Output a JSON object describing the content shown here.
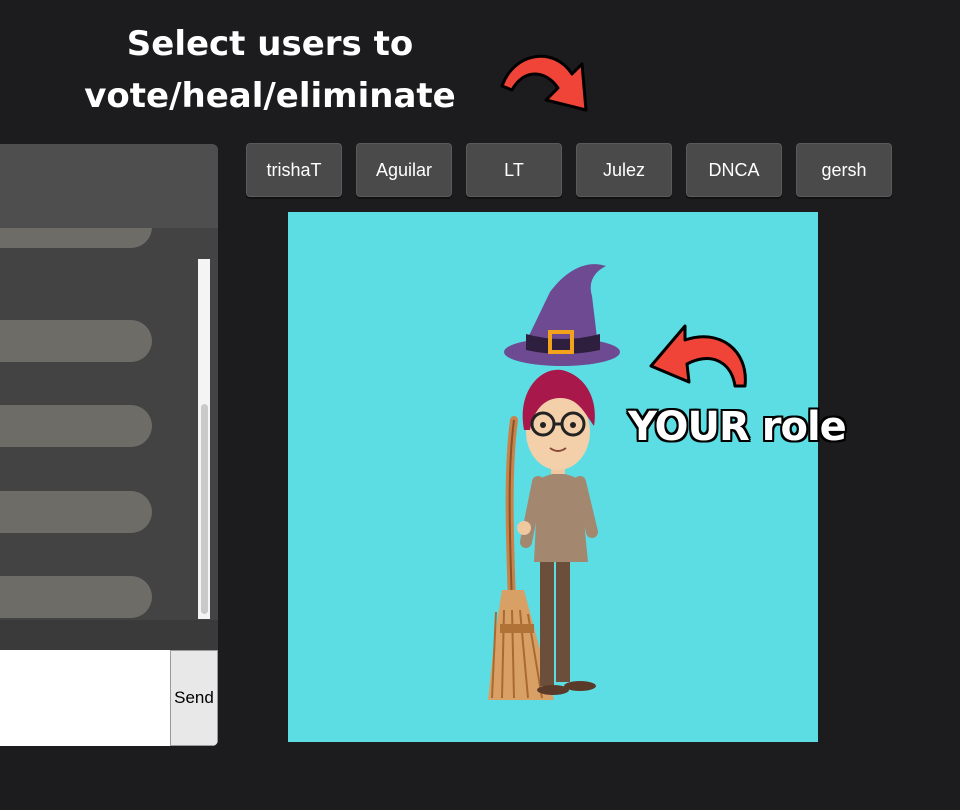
{
  "headline": {
    "line1": "Select users to",
    "line2": "vote/heal/eliminate"
  },
  "role_annotation": "YOUR role",
  "users": [
    "trishaT",
    "Aguilar",
    "LT",
    "Julez",
    "DNCA",
    "gersh"
  ],
  "chat": {
    "input_value": "",
    "send_label": "Send"
  },
  "role": {
    "character": "witch-with-broom"
  },
  "colors": {
    "background": "#1c1c1e",
    "arrow": "#f04438",
    "card": "#5bdde3",
    "user_button": "#4a4a4a"
  }
}
